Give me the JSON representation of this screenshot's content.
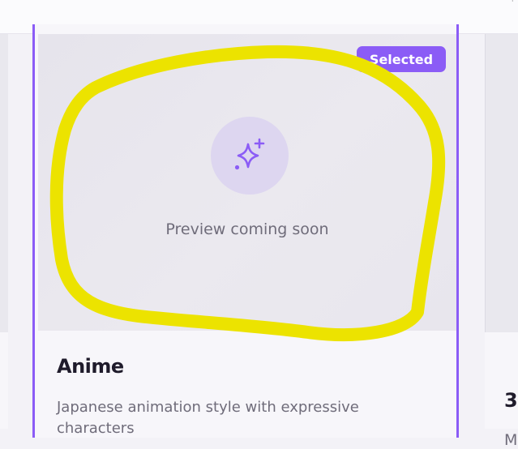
{
  "card": {
    "badge": "Selected",
    "preview_text": "Preview coming soon",
    "preview_icon": "sparkles-icon",
    "title": "Anime",
    "description": "Japanese animation style with expressive characters"
  },
  "next_card": {
    "title_fragment": "3",
    "description_fragment": "M"
  },
  "colors": {
    "accent": "#8b5cf6",
    "highlight": "#ece300"
  }
}
